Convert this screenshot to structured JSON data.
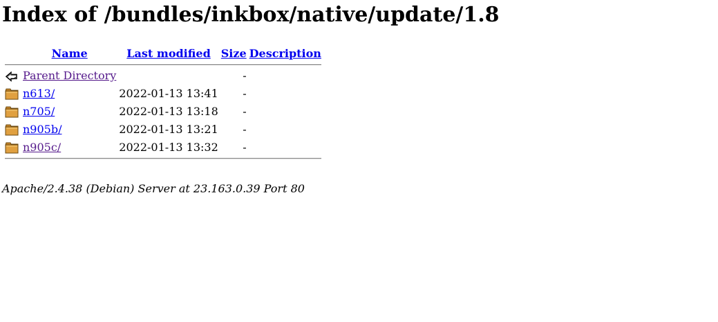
{
  "page_title": "Index of /bundles/inkbox/native/update/1.8",
  "columns": {
    "name": "Name",
    "last_modified": "Last modified",
    "size": "Size",
    "description": "Description"
  },
  "rows": [
    {
      "icon": "back-icon",
      "name": "Parent Directory",
      "modified": "",
      "size": "-",
      "description": "",
      "visited": true
    },
    {
      "icon": "folder-icon",
      "name": "n613/",
      "modified": "2022-01-13 13:41",
      "size": "-",
      "description": "",
      "visited": false
    },
    {
      "icon": "folder-icon",
      "name": "n705/",
      "modified": "2022-01-13 13:18",
      "size": "-",
      "description": "",
      "visited": false
    },
    {
      "icon": "folder-icon",
      "name": "n905b/",
      "modified": "2022-01-13 13:21",
      "size": "-",
      "description": "",
      "visited": false
    },
    {
      "icon": "folder-icon",
      "name": "n905c/",
      "modified": "2022-01-13 13:32",
      "size": "-",
      "description": "",
      "visited": true
    }
  ],
  "footer": "Apache/2.4.38 (Debian) Server at 23.163.0.39 Port 80",
  "colors": {
    "link": "#0000ee",
    "visited_link": "#551a8b",
    "folder_fill": "#e0a040",
    "folder_stroke": "#6b4a12"
  }
}
